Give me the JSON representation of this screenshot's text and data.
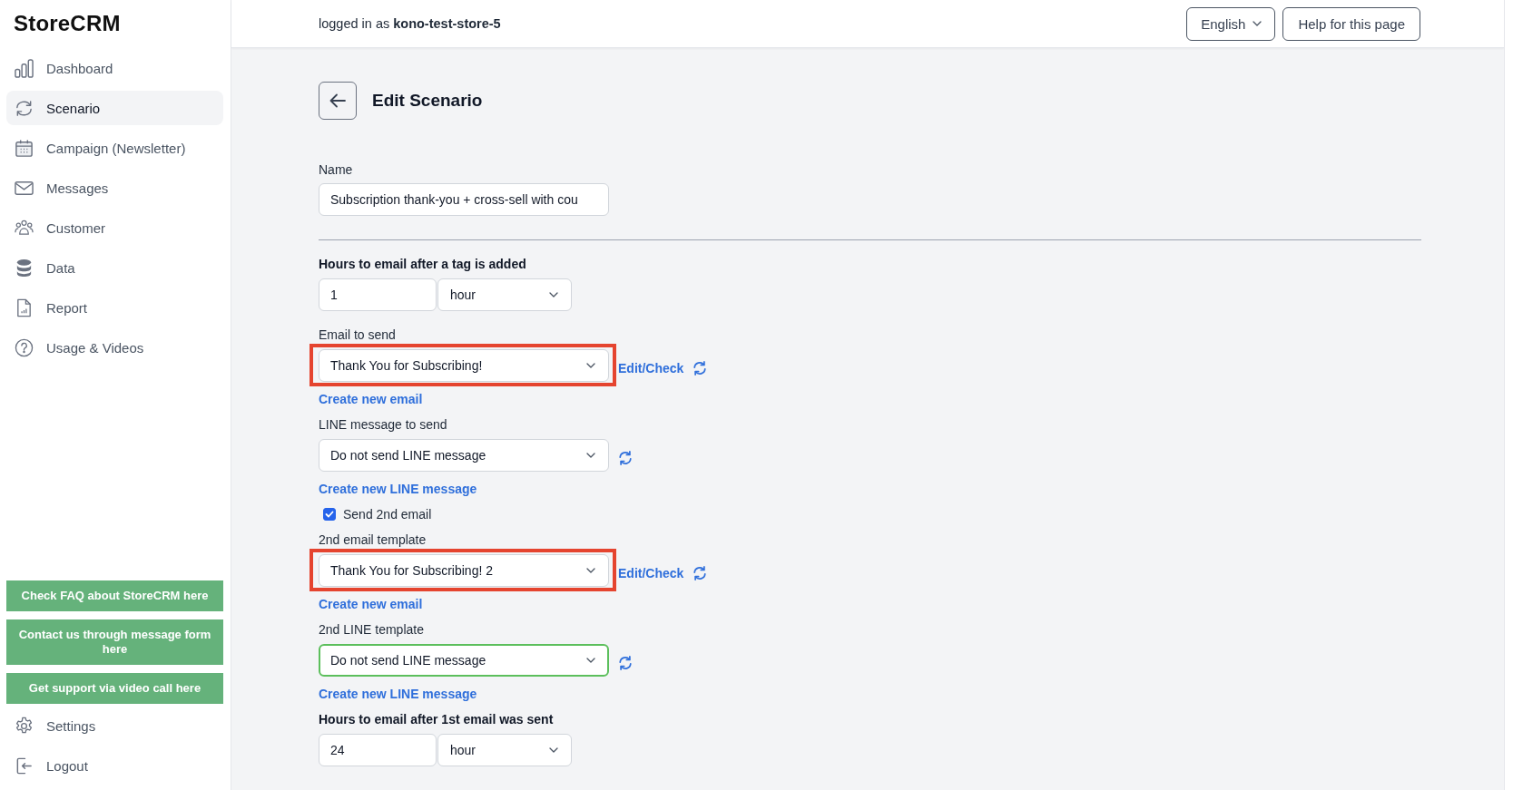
{
  "sidebar": {
    "logo": "StoreCRM",
    "nav_items": [
      {
        "label": "Dashboard",
        "selected": false
      },
      {
        "label": "Scenario",
        "selected": true
      },
      {
        "label": "Campaign (Newsletter)",
        "selected": false
      },
      {
        "label": "Messages",
        "selected": false
      },
      {
        "label": "Customer",
        "selected": false
      },
      {
        "label": "Data",
        "selected": false
      },
      {
        "label": "Report",
        "selected": false
      },
      {
        "label": "Usage & Videos",
        "selected": false
      }
    ],
    "support_buttons": [
      "Check FAQ about StoreCRM here",
      "Contact us through message form here",
      "Get support via video call here"
    ],
    "bottom_items": [
      {
        "label": "Settings"
      },
      {
        "label": "Logout"
      }
    ]
  },
  "header": {
    "login_status": "logged in as **kono-test-store-5**",
    "language": "English",
    "help_button": "Help for this page"
  },
  "page": {
    "title": "Edit Scenario"
  },
  "form": {
    "name_field": {
      "label": "Name",
      "value": "Subscription thank-you + cross-sell with cou"
    },
    "fields": [
      {
        "kind": "duration",
        "label": "Hours to email after a tag is added",
        "value": "1",
        "unit": "hour"
      },
      {
        "kind": "select",
        "label": "Email to send",
        "value": "Thank You for Subscribing!",
        "highlighted": true,
        "focused": false,
        "edit_link": "Edit/Check",
        "create_link": "Create new email"
      },
      {
        "kind": "select",
        "label": "LINE message to send",
        "value": "Do not send LINE message",
        "highlighted": false,
        "focused": false,
        "create_link": "Create new LINE message"
      },
      {
        "kind": "checkbox",
        "label": "Send 2nd email",
        "checked": true
      },
      {
        "kind": "select",
        "label": "2nd email template",
        "value": "Thank You for Subscribing! 2",
        "highlighted": true,
        "focused": false,
        "edit_link": "Edit/Check",
        "create_link": "Create new email"
      },
      {
        "kind": "select",
        "label": "2nd LINE template",
        "value": "Do not send LINE message",
        "highlighted": false,
        "focused": true,
        "create_link": "Create new LINE message"
      },
      {
        "kind": "duration",
        "label": "Hours to email after 1st email was sent",
        "value": "24",
        "unit": "hour"
      }
    ]
  }
}
